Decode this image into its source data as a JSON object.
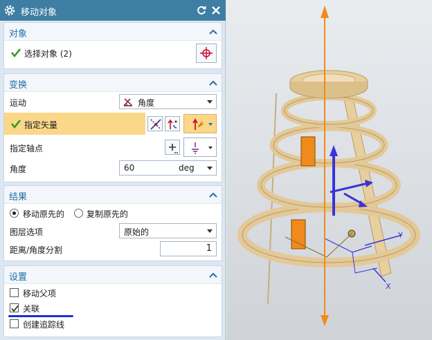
{
  "dialog": {
    "title": "移动对象",
    "icons": {
      "settings": "gear-icon",
      "reset": "reset-icon",
      "close": "close-icon"
    }
  },
  "object_section": {
    "title": "对象",
    "select_label": "选择对象 (2)",
    "select_button_icon": "crosshair-icon"
  },
  "transform_section": {
    "title": "变换",
    "motion_label": "运动",
    "motion_value": "角度",
    "vector_label": "指定矢量",
    "pivot_label": "指定轴点",
    "angle_label": "角度",
    "angle_value": "60",
    "angle_unit": "deg"
  },
  "result_section": {
    "title": "结果",
    "move_original": "移动原先的",
    "copy_original": "复制原先的",
    "move_original_selected": true,
    "layer_label": "图层选项",
    "layer_value": "原始的",
    "split_label": "距离/角度分割",
    "split_value": "1"
  },
  "settings_section": {
    "title": "设置",
    "move_parent": "移动父项",
    "move_parent_checked": false,
    "associate": "关联",
    "associate_checked": true,
    "trace_lines": "创建追踪线",
    "trace_lines_checked": false
  },
  "viewport": {
    "axis_y": "Y",
    "axis_x": "X"
  },
  "colors": {
    "title_bar": "#3f7ea3",
    "section_title": "#1f6fa8",
    "highlight_row": "#fbd78a",
    "check_green": "#2f9e1e",
    "model_tan": "#e3c998",
    "vector_orange": "#f08a1c",
    "axis_blue": "#3b33d6"
  }
}
